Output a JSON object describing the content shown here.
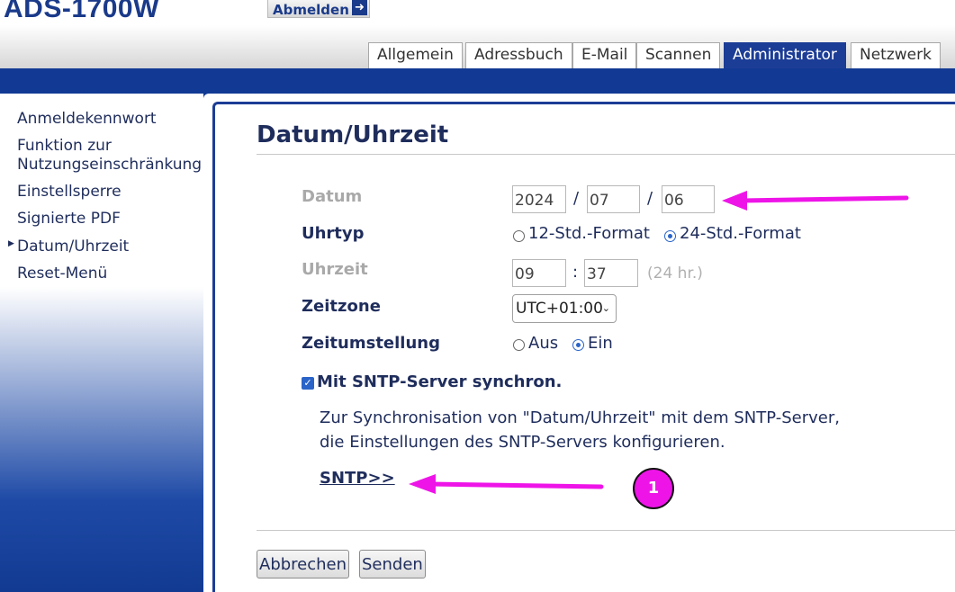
{
  "header": {
    "model": "ADS-1700W",
    "logout_label": "Abmelden",
    "logout_icon": "logout-arrow-icon"
  },
  "tabs": [
    {
      "label": "Allgemein",
      "active": false
    },
    {
      "label": "Adressbuch",
      "active": false
    },
    {
      "label": "E-Mail",
      "active": false
    },
    {
      "label": "Scannen",
      "active": false
    },
    {
      "label": "Administrator",
      "active": true
    },
    {
      "label": "Netzwerk",
      "active": false
    }
  ],
  "sidebar": {
    "items": [
      {
        "label": "Anmeldekennwort"
      },
      {
        "label_line1": "Funktion zur",
        "label_line2": "Nutzungseinschränkung"
      },
      {
        "label": "Einstellsperre"
      },
      {
        "label": "Signierte PDF"
      },
      {
        "label": "Datum/Uhrzeit",
        "active": true
      },
      {
        "label": "Reset-Menü"
      }
    ]
  },
  "main": {
    "title": "Datum/Uhrzeit",
    "date": {
      "label": "Datum",
      "year": "2024",
      "month": "07",
      "day": "06",
      "separator": "/"
    },
    "clock_type": {
      "label": "Uhrtyp",
      "option_12": "12-Std.-Format",
      "option_24": "24-Std.-Format",
      "selected": "24"
    },
    "time": {
      "label": "Uhrzeit",
      "hour": "09",
      "minute": "37",
      "separator": ":",
      "hint": "(24 hr.)"
    },
    "timezone": {
      "label": "Zeitzone",
      "value": "UTC+01:00"
    },
    "dst": {
      "label": "Zeitumstellung",
      "option_off": "Aus",
      "option_on": "Ein",
      "selected": "on"
    },
    "sntp": {
      "checkbox_label": "Mit SNTP-Server synchron.",
      "checked": true,
      "desc_line1": "Zur Synchronisation von \"Datum/Uhrzeit\" mit dem SNTP-Server,",
      "desc_line2": "die Einstellungen des SNTP-Servers konfigurieren.",
      "link": "SNTP>>"
    },
    "buttons": {
      "cancel": "Abbrechen",
      "submit": "Senden"
    }
  },
  "annotations": {
    "badge": "1",
    "arrow_color": "#ee14e8"
  }
}
